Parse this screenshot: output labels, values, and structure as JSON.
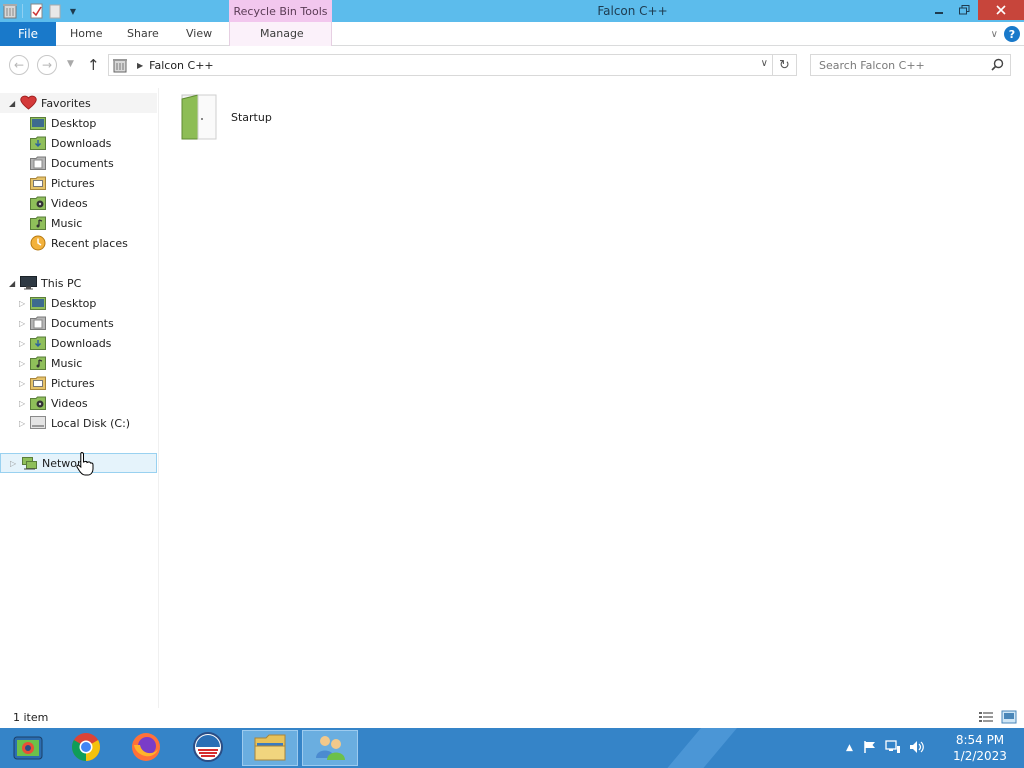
{
  "window": {
    "title": "Falcon C++",
    "context_tab_group": "Recycle Bin Tools"
  },
  "ribbon": {
    "tabs": [
      {
        "label": "File"
      },
      {
        "label": "Home"
      },
      {
        "label": "Share"
      },
      {
        "label": "View"
      },
      {
        "label": "Manage"
      }
    ],
    "help_label": "?"
  },
  "address": {
    "path": "Falcon C++",
    "search_placeholder": "Search Falcon C++"
  },
  "nav": {
    "favorites": {
      "label": "Favorites",
      "items": [
        {
          "label": "Desktop"
        },
        {
          "label": "Downloads"
        },
        {
          "label": "Documents"
        },
        {
          "label": "Pictures"
        },
        {
          "label": "Videos"
        },
        {
          "label": "Music"
        },
        {
          "label": "Recent places"
        }
      ]
    },
    "this_pc": {
      "label": "This PC",
      "items": [
        {
          "label": "Desktop"
        },
        {
          "label": "Documents"
        },
        {
          "label": "Downloads"
        },
        {
          "label": "Music"
        },
        {
          "label": "Pictures"
        },
        {
          "label": "Videos"
        },
        {
          "label": "Local Disk (C:)"
        }
      ]
    },
    "network": {
      "label": "Network"
    }
  },
  "content": {
    "items": [
      {
        "label": "Startup",
        "icon": "folder-icon"
      }
    ]
  },
  "status": {
    "count": "1 item"
  },
  "taskbar": {
    "apps": [
      {
        "name": "server-manager-icon"
      },
      {
        "name": "chrome-icon"
      },
      {
        "name": "firefox-icon"
      },
      {
        "name": "obama-logo-icon"
      },
      {
        "name": "file-explorer-icon"
      },
      {
        "name": "users-icon"
      }
    ],
    "clock": {
      "time": "8:54 PM",
      "date": "1/2/2023"
    }
  },
  "colors": {
    "titlebar": "#5cbcec",
    "file_tab": "#1979ca",
    "context_tab": "#f2c7ee",
    "taskbar": "#3584c8",
    "close_button": "#c7453b"
  }
}
